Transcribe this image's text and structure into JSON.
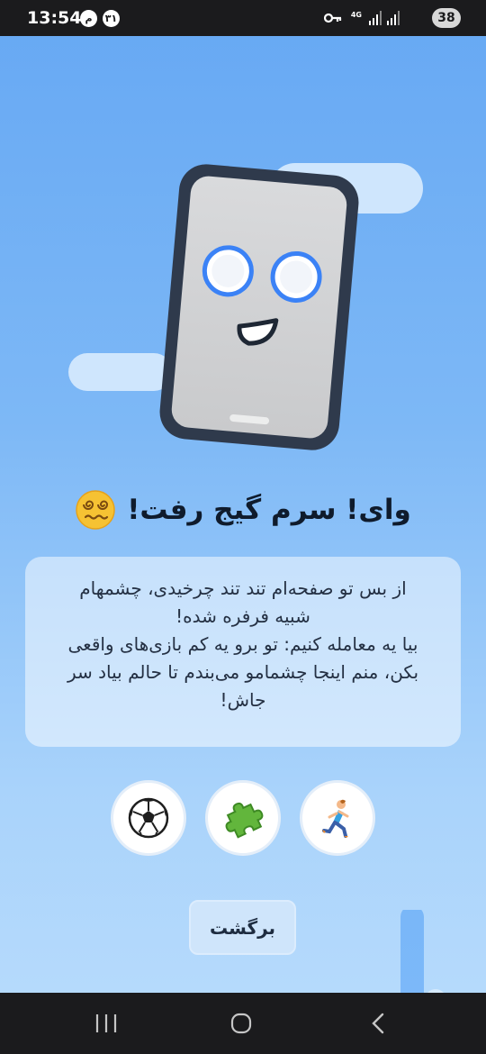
{
  "status_bar": {
    "time": "13:54",
    "notif_1": "م",
    "notif_2": "۳۱",
    "network": "4G",
    "battery": "38"
  },
  "title": "وای! سرم گیج رفت!",
  "message": "از بس تو صفحه‌ام تند تند چرخیدی، چشمهام\nشبیه فرفره شده!\nبیا یه معامله کنیم: تو برو یه کم بازی‌های واقعی\nبکن، منم اینجا چشمامو می‌بندم تا حالم بیاد سر\nجاش!",
  "activities": [
    {
      "icon": "soccer-ball-icon"
    },
    {
      "icon": "puzzle-piece-icon"
    },
    {
      "icon": "running-person-icon"
    }
  ],
  "back_label": "برگشت",
  "colors": {
    "background_top": "#66a8f3",
    "background_bottom": "#b9dcfc",
    "card_bg": "#ffffff80",
    "eye_ring": "#3b82f6",
    "phone_frame": "#2f3a4c"
  }
}
